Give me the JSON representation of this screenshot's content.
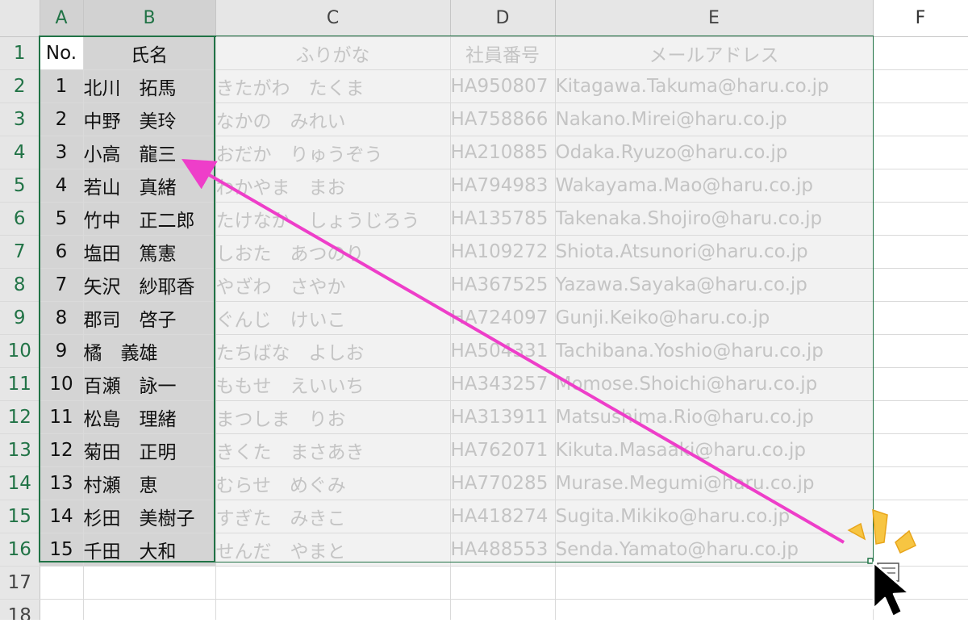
{
  "columns": [
    "A",
    "B",
    "C",
    "D",
    "E",
    "F"
  ],
  "headers": {
    "no": "No.",
    "name": "氏名",
    "kana": "ふりがな",
    "employee_id": "社員番号",
    "email": "メールアドレス"
  },
  "rows": [
    {
      "no": "1",
      "name": "北川　拓馬",
      "kana": "きたがわ　たくま",
      "id": "HA950807",
      "email": "Kitagawa.Takuma@haru.co.jp"
    },
    {
      "no": "2",
      "name": "中野　美玲",
      "kana": "なかの　みれい",
      "id": "HA758866",
      "email": "Nakano.Mirei@haru.co.jp"
    },
    {
      "no": "3",
      "name": "小高　龍三",
      "kana": "おだか　りゅうぞう",
      "id": "HA210885",
      "email": "Odaka.Ryuzo@haru.co.jp"
    },
    {
      "no": "4",
      "name": "若山　真緒",
      "kana": "わかやま　まお",
      "id": "HA794983",
      "email": "Wakayama.Mao@haru.co.jp"
    },
    {
      "no": "5",
      "name": "竹中　正二郎",
      "kana": "たけなか　しょうじろう",
      "id": "HA135785",
      "email": "Takenaka.Shojiro@haru.co.jp"
    },
    {
      "no": "6",
      "name": "塩田　篤憲",
      "kana": "しおた　あつのり",
      "id": "HA109272",
      "email": "Shiota.Atsunori@haru.co.jp"
    },
    {
      "no": "7",
      "name": "矢沢　紗耶香",
      "kana": "やざわ　さやか",
      "id": "HA367525",
      "email": "Yazawa.Sayaka@haru.co.jp"
    },
    {
      "no": "8",
      "name": "郡司　啓子",
      "kana": "ぐんじ　けいこ",
      "id": "HA724097",
      "email": "Gunji.Keiko@haru.co.jp"
    },
    {
      "no": "9",
      "name": "橘　義雄",
      "kana": "たちばな　よしお",
      "id": "HA504331",
      "email": "Tachibana.Yoshio@haru.co.jp"
    },
    {
      "no": "10",
      "name": "百瀬　詠一",
      "kana": "ももせ　えいいち",
      "id": "HA343257",
      "email": "Momose.Shoichi@haru.co.jp"
    },
    {
      "no": "11",
      "name": "松島　理緒",
      "kana": "まつしま　りお",
      "id": "HA313911",
      "email": "Matsushima.Rio@haru.co.jp"
    },
    {
      "no": "12",
      "name": "菊田　正明",
      "kana": "きくた　まさあき",
      "id": "HA762071",
      "email": "Kikuta.Masaaki@haru.co.jp"
    },
    {
      "no": "13",
      "name": "村瀬　恵",
      "kana": "むらせ　めぐみ",
      "id": "HA770285",
      "email": "Murase.Megumi@haru.co.jp"
    },
    {
      "no": "14",
      "name": "杉田　美樹子",
      "kana": "すぎた　みきこ",
      "id": "HA418274",
      "email": "Sugita.Mikiko@haru.co.jp"
    },
    {
      "no": "15",
      "name": "千田　大和",
      "kana": "せんだ　やまと",
      "id": "HA488553",
      "email": "Senda.Yamato@haru.co.jp"
    }
  ],
  "row_numbers": [
    "1",
    "2",
    "3",
    "4",
    "5",
    "6",
    "7",
    "8",
    "9",
    "10",
    "11",
    "12",
    "13",
    "14",
    "15",
    "16",
    "17",
    "18"
  ],
  "colors": {
    "selection": "#217346",
    "arrow": "#ee3ec9",
    "sparkle": "#f7c542",
    "cursor": "#000000"
  },
  "icons": {
    "cursor": "mouse-pointer-icon",
    "sparkle": "sparkle-icon",
    "arrow": "drag-arrow-icon",
    "quick_analysis": "quick-analysis-icon"
  }
}
